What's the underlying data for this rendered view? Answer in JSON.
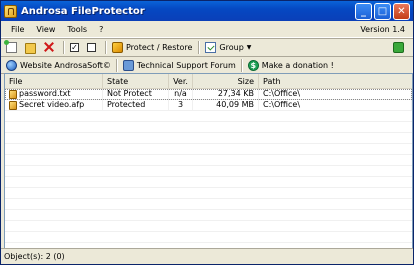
{
  "window": {
    "title": "Androsa FileProtector"
  },
  "menu": {
    "items": [
      "File",
      "View",
      "Tools",
      "?"
    ],
    "version": "Version 1.4"
  },
  "toolbar": {
    "protect_label": "Protect / Restore",
    "group_label": "Group"
  },
  "linkbar": {
    "website_label": "Website AndrosaSoft©",
    "forum_label": "Technical Support Forum",
    "donate_label": "Make a donation !"
  },
  "table": {
    "columns": [
      "File",
      "State",
      "Ver.",
      "Size",
      "Path"
    ],
    "rows": [
      {
        "file": "password.txt",
        "state": "Not Protect",
        "ver": "n/a",
        "size": "27,34 KB",
        "path": "C:\\Office\\"
      },
      {
        "file": "Secret video.afp",
        "state": "Protected",
        "ver": "3",
        "size": "40,09 MB",
        "path": "C:\\Office\\"
      }
    ]
  },
  "status": {
    "text": "Object(s): 2 (0)"
  },
  "colors": {
    "title_bar": "#0548c2",
    "chrome": "#ece9d8",
    "close_button": "#c33d16"
  }
}
